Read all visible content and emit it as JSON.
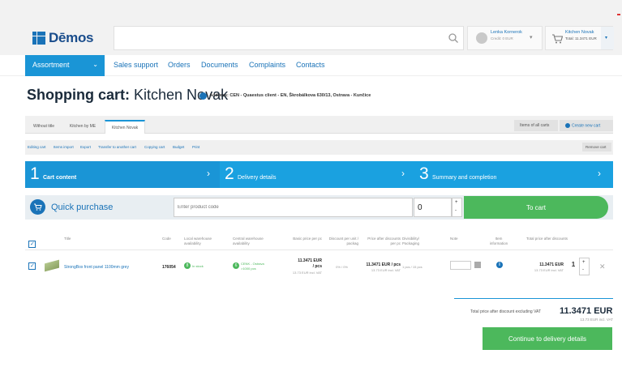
{
  "brand": {
    "name": "Dēmos"
  },
  "header": {
    "search_placeholder": "",
    "user": {
      "name": "Lenka Kornerok",
      "sub": "Credit: 0 EUR"
    },
    "cart": {
      "name": "Kitchen Novak",
      "total": "Total: 11.3471 EUR"
    }
  },
  "nav": {
    "assortment": "Assortment",
    "links": [
      "Sales support",
      "Orders",
      "Documents",
      "Complaints",
      "Contacts"
    ]
  },
  "page": {
    "title_prefix": "Shopping cart:",
    "title_name": "Kitchen Novak",
    "address": "Address: CEN - Quaestus client - EN, Škrobálkova 630/13, Ostrava - Kunčice"
  },
  "tabs": {
    "items": [
      "Without title",
      "Kitchen by ME",
      "Kitchen Novak"
    ],
    "active_index": 2,
    "items_of_all_carts": "Items of all carts",
    "create_new_cart": "Create new cart"
  },
  "toolbar": {
    "links": [
      "Editing cart",
      "Items import",
      "Export",
      "Transfer to another cart",
      "Copying cart",
      "Budget",
      "Print"
    ],
    "remove_cart": "Remove cart"
  },
  "steps": [
    {
      "num": "1",
      "label": "Cart content",
      "active": true
    },
    {
      "num": "2",
      "label": "Delivery details",
      "active": false
    },
    {
      "num": "3",
      "label": "Summary and completion",
      "active": false
    }
  ],
  "quick_purchase": {
    "label": "Quick purchase",
    "placeholder": "Enter product code",
    "qty": "0",
    "to_cart": "To cart"
  },
  "table": {
    "headers": {
      "title": "Title",
      "code": "Code",
      "local": "Local warehouse availability",
      "central": "Central warehouse availability",
      "basic": "Basic price per pc",
      "discount": "Discount per unit / packag",
      "after": "Price after discounts per pc",
      "divis": "Divisibility/ Packaging",
      "note": "Note",
      "info": "Item information",
      "total": "Total price after discounts"
    },
    "rows": [
      {
        "name": "StrongBox front panel 1100mm grey",
        "code": "176054",
        "local_count": "8",
        "local_text": "In stock",
        "central_count": "6",
        "central_text": "CENK - Ostrava",
        "central_text2": ">1000 pcs",
        "basic_price": "11.3471 EUR",
        "basic_unit": "/ pcs",
        "basic_vat": "13.73 EUR incl. VAT",
        "discount": "0% / 0%",
        "after_price": "11.3471 EUR / pcs",
        "after_vat": "13.73 EUR incl. VAT",
        "divis": "1 pcs / 15 pcs",
        "total": "11.3471 EUR",
        "total_vat": "13.73 EUR incl. VAT",
        "qty": "1"
      }
    ]
  },
  "totals": {
    "label": "Total price after discount excluding VAT",
    "value": "11.3471 EUR",
    "vat": "13.73 EUR incl. VAT"
  },
  "continue_label": "Continue to delivery details",
  "colors": {
    "accent": "#1a95d6",
    "green": "#4cb85c",
    "brand": "#1a4d8c"
  }
}
